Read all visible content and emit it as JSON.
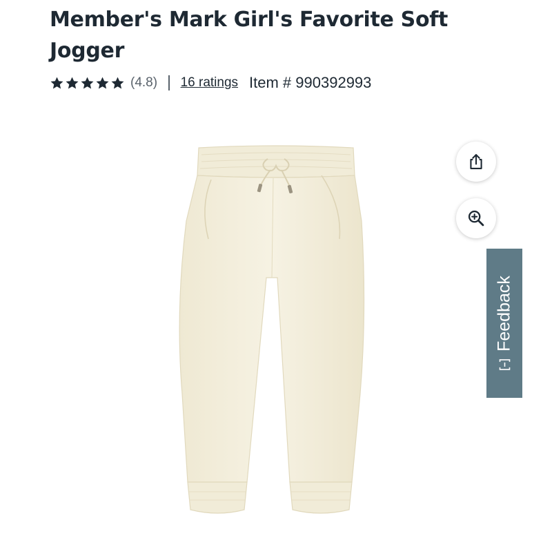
{
  "product": {
    "title": "Member's Mark Girl's Favorite Soft Jogger",
    "rating_value": "(4.8)",
    "rating": 4.8,
    "ratings_link": "16 ratings",
    "item_number": "Item # 990392993"
  },
  "actions": {
    "share_icon": "share-icon",
    "zoom_icon": "zoom-in-icon"
  },
  "feedback": {
    "label": "Feedback"
  },
  "colors": {
    "title": "#1e2933",
    "stars": "#1e2933",
    "feedback_bg": "#5f7b87",
    "product_fabric": "#f3eedc"
  }
}
